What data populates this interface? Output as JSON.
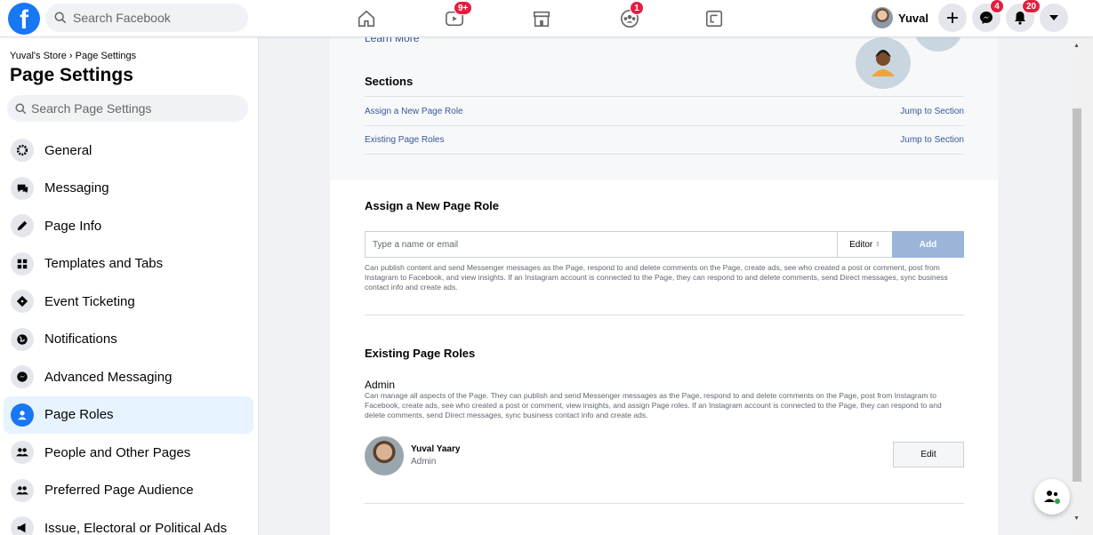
{
  "topbar": {
    "search_placeholder": "Search Facebook",
    "logo_letter": "f",
    "badges": {
      "watch": "9+",
      "groups": "1",
      "messenger": "4",
      "notifications": "20"
    },
    "profile_name": "Yuval"
  },
  "sidebar": {
    "breadcrumb": "Yuval's Store › Page Settings",
    "title": "Page Settings",
    "search_placeholder": "Search Page Settings",
    "items": [
      {
        "label": "General",
        "icon": "gear-icon"
      },
      {
        "label": "Messaging",
        "icon": "chat-icon"
      },
      {
        "label": "Page Info",
        "icon": "pencil-icon"
      },
      {
        "label": "Templates and Tabs",
        "icon": "grid-icon"
      },
      {
        "label": "Event Ticketing",
        "icon": "ticket-icon"
      },
      {
        "label": "Notifications",
        "icon": "globe-icon"
      },
      {
        "label": "Advanced Messaging",
        "icon": "messenger-icon"
      },
      {
        "label": "Page Roles",
        "icon": "person-icon",
        "active": true
      },
      {
        "label": "People and Other Pages",
        "icon": "people-icon"
      },
      {
        "label": "Preferred Page Audience",
        "icon": "people-icon"
      },
      {
        "label": "Issue, Electoral or Political Ads",
        "icon": "megaphone-icon"
      }
    ]
  },
  "sections": {
    "learn_more": "Learn More",
    "title": "Sections",
    "rows": [
      {
        "label": "Assign a New Page Role",
        "jump": "Jump to Section"
      },
      {
        "label": "Existing Page Roles",
        "jump": "Jump to Section"
      }
    ]
  },
  "assign": {
    "title": "Assign a New Page Role",
    "input_placeholder": "Type a name or email",
    "role_select": "Editor",
    "add_label": "Add",
    "description": "Can publish content and send Messenger messages as the Page, respond to and delete comments on the Page, create ads, see who created a post or comment, post from Instagram to Facebook, and view insights. If an Instagram account is connected to the Page, they can respond to and delete comments, send Direct messages, sync business contact info and create ads."
  },
  "existing": {
    "title": "Existing Page Roles",
    "role": "Admin",
    "description": "Can manage all aspects of the Page. They can publish and send Messenger messages as the Page, respond to and delete comments on the Page, post from Instagram to Facebook, create ads, see who created a post or comment, view insights, and assign Page roles. If an Instagram account is connected to the Page, they can respond to and delete comments, send Direct messages, sync business contact info and create ads.",
    "person_name": "Yuval Yaary",
    "person_role": "Admin",
    "edit_label": "Edit"
  },
  "colors": {
    "brand": "#1877f2",
    "badge": "#e41e3f",
    "link": "#385898",
    "active_bg": "#e7f3ff"
  }
}
